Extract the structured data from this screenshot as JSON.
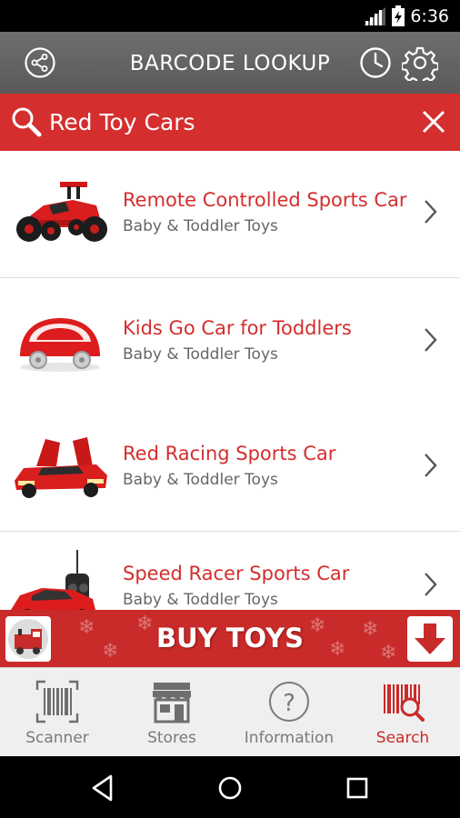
{
  "status": {
    "time": "6:36"
  },
  "header": {
    "title": "BARCODE LOOKUP"
  },
  "search": {
    "value": "Red Toy Cars"
  },
  "results": [
    {
      "name": "Remote Controlled Sports Car",
      "category": "Baby & Toddler Toys"
    },
    {
      "name": "Kids Go Car for Toddlers",
      "category": "Baby & Toddler Toys"
    },
    {
      "name": "Red Racing Sports Car",
      "category": "Baby & Toddler Toys"
    },
    {
      "name": "Speed Racer Sports Car",
      "category": "Baby & Toddler Toys"
    }
  ],
  "banner": {
    "label": "BUY TOYS"
  },
  "tabs": [
    {
      "label": "Scanner",
      "icon": "barcode-icon"
    },
    {
      "label": "Stores",
      "icon": "store-icon"
    },
    {
      "label": "Information",
      "icon": "question-icon"
    },
    {
      "label": "Search",
      "icon": "barcode-search-icon",
      "active": true
    }
  ],
  "colors": {
    "accent": "#d42e2e",
    "appbar": "#636363",
    "tab_active": "#c92a2a",
    "tab_inactive": "#7a7a7a"
  }
}
